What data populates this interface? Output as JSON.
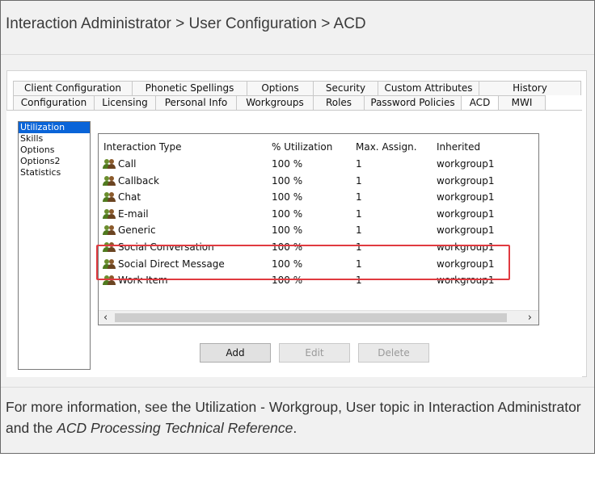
{
  "header": {
    "breadcrumb": "Interaction Administrator > User Configuration >  ACD"
  },
  "tabs_row1": [
    {
      "label": "Client Configuration"
    },
    {
      "label": "Phonetic Spellings"
    },
    {
      "label": "Options"
    },
    {
      "label": "Security"
    },
    {
      "label": "Custom Attributes"
    },
    {
      "label": "History"
    }
  ],
  "tabs_row2": [
    {
      "label": "Configuration"
    },
    {
      "label": "Licensing"
    },
    {
      "label": "Personal Info"
    },
    {
      "label": "Workgroups"
    },
    {
      "label": "Roles"
    },
    {
      "label": "Password Policies"
    },
    {
      "label": "ACD"
    },
    {
      "label": "MWI"
    }
  ],
  "sidebar": {
    "items": [
      {
        "label": "Utilization"
      },
      {
        "label": "Skills"
      },
      {
        "label": "Options"
      },
      {
        "label": "Options2"
      },
      {
        "label": "Statistics"
      }
    ]
  },
  "table": {
    "columns": [
      "Interaction Type",
      "% Utilization",
      "Max. Assign.",
      "Inherited"
    ],
    "rows": [
      [
        "Call",
        "100 %",
        "1",
        "workgroup1"
      ],
      [
        "Callback",
        "100 %",
        "1",
        "workgroup1"
      ],
      [
        "Chat",
        "100 %",
        "1",
        "workgroup1"
      ],
      [
        "E-mail",
        "100 %",
        "1",
        "workgroup1"
      ],
      [
        "Generic",
        "100 %",
        "1",
        "workgroup1"
      ],
      [
        "Social Conversation",
        "100 %",
        "1",
        "workgroup1"
      ],
      [
        "Social Direct Message",
        "100 %",
        "1",
        "workgroup1"
      ],
      [
        "Work Item",
        "100 %",
        "1",
        "workgroup1"
      ]
    ]
  },
  "buttons": {
    "add": "Add",
    "edit": "Edit",
    "delete": "Delete"
  },
  "scroll": {
    "left": "‹",
    "right": "›"
  },
  "note": {
    "text_before": "For more information, see the Utilization - Workgroup, User topic in Interaction Administrator and the ",
    "italic": "ACD Processing Technical Reference",
    "text_after": "."
  },
  "colors": {
    "highlight": "#e03a40",
    "selection": "#0a64d8"
  }
}
